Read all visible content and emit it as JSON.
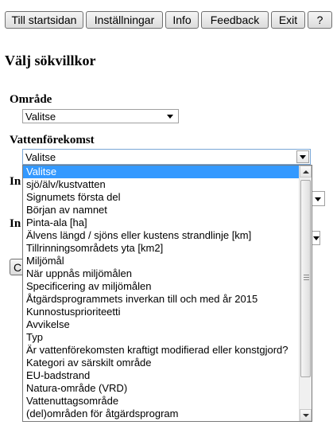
{
  "toolbar": {
    "buttons": [
      "Till startsidan",
      "Inställningar",
      "Info",
      "Feedback",
      "Exit",
      "?"
    ]
  },
  "heading": "Välj sökvillkor",
  "omrade": {
    "label": "Område",
    "selected": "Valitse"
  },
  "vattenforekomst": {
    "label": "Vattenförekomst",
    "selected": "Valitse",
    "options": [
      "Valitse",
      "sjö/älv/kustvatten",
      "Signumets första del",
      "Början av namnet",
      "Pinta-ala [ha]",
      "Älvens längd / sjöns eller kustens strandlinje [km]",
      "Tillrinningsområdets yta [km2]",
      "Miljömål",
      "När uppnås miljömålen",
      "Specificering av miljömålen",
      "Åtgärdsprogrammets inverkan till och med år 2015",
      "Kunnostusprioriteetti",
      "Avvikelse",
      "Typ",
      "Är vattenförekomsten kraftigt modifierad eller konstgjord?",
      "Kategori av särskilt område",
      "EU-badstrand",
      "Natura-område (VRD)",
      "Vattenuttagsområde",
      "(del)områden för åtgärdsprogram"
    ]
  },
  "obscured": {
    "label_1": "In",
    "label_2": "In",
    "button": "C"
  },
  "colors": {
    "selection": "#3399ff",
    "focus_border": "#7aa7d6"
  }
}
